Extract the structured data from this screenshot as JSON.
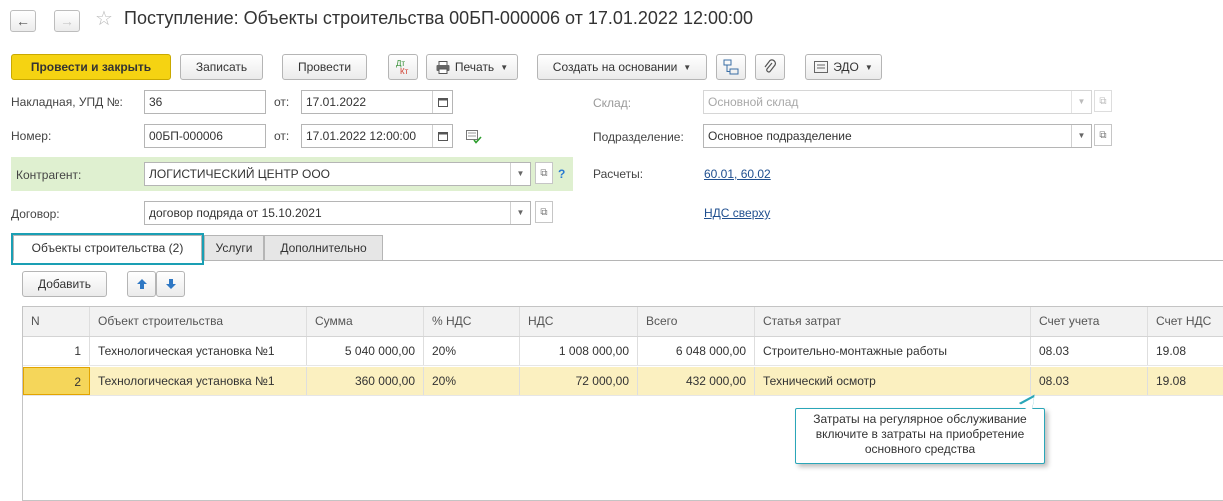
{
  "window": {
    "title": "Поступление: Объекты строительства 00БП-000006 от 17.01.2022 12:00:00",
    "back_icon": "←",
    "forward_icon": "→",
    "star_icon": "☆"
  },
  "toolbar": {
    "post_and_close": "Провести и закрыть",
    "save": "Записать",
    "post": "Провести",
    "dt_kt": "Дт\nКт",
    "print": "Печать",
    "create_based": "Создать на основании",
    "edo": "ЭДО"
  },
  "form": {
    "invoice_label": "Накладная, УПД №:",
    "invoice_number": "36",
    "from_label": "от:",
    "invoice_date": "17.01.2022",
    "number_label": "Номер:",
    "number": "00БП-000006",
    "from_label2": "от:",
    "number_date": "17.01.2022 12:00:00",
    "counterparty_label": "Контрагент:",
    "counterparty": "ЛОГИСТИЧЕСКИЙ ЦЕНТР ООО",
    "help": "?",
    "contract_label": "Договор:",
    "contract": "договор подряда от 15.10.2021",
    "warehouse_label": "Склад:",
    "warehouse": "Основной склад",
    "department_label": "Подразделение:",
    "department": "Основное подразделение",
    "settlements_label": "Расчеты:",
    "settlements_link": "60.01, 60.02",
    "vat_link": "НДС сверху"
  },
  "tabs": [
    {
      "label": "Объекты строительства (2)"
    },
    {
      "label": "Услуги"
    },
    {
      "label": "Дополнительно"
    }
  ],
  "table_toolbar": {
    "add": "Добавить"
  },
  "table": {
    "headers": [
      "N",
      "Объект строительства",
      "Сумма",
      "% НДС",
      "НДС",
      "Всего",
      "Статья затрат",
      "Счет учета",
      "Счет НДС"
    ],
    "rows": [
      [
        "1",
        "Технологическая установка №1",
        "5 040 000,00",
        "20%",
        "1 008 000,00",
        "6 048 000,00",
        "Строительно-монтажные работы",
        "08.03",
        "19.08"
      ],
      [
        "2",
        "Технологическая установка №1",
        "360 000,00",
        "20%",
        "72 000,00",
        "432 000,00",
        "Технический осмотр",
        "08.03",
        "19.08"
      ]
    ]
  },
  "tooltip": {
    "line1": "Затраты на регулярное обслуживание",
    "line2": "включите в затраты на приобретение",
    "line3": "основного средства"
  },
  "colors": {
    "primary_button": "#f5d312",
    "link": "#1f4f8f",
    "selected_row": "#fbf0c0",
    "highlight_frame": "#1a9fb4",
    "counterparty_bg": "#dff0d0"
  }
}
